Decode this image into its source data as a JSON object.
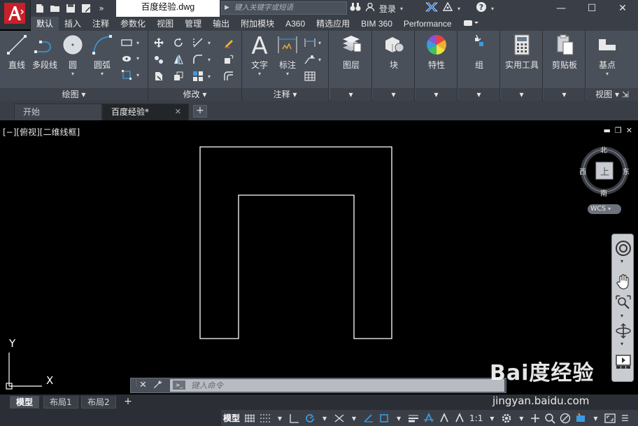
{
  "title_bar": {
    "doc_tab": "百度经验.dwg",
    "search_placeholder": "键入关键字或短语",
    "login_label": "登录",
    "help_icon": "help-icon",
    "minimize": "—",
    "maximize": "☐",
    "close": "✕"
  },
  "ribbon_tabs": [
    "默认",
    "插入",
    "注释",
    "参数化",
    "视图",
    "管理",
    "输出",
    "附加模块",
    "A360",
    "精选应用",
    "BIM 360",
    "Performance"
  ],
  "ribbon": {
    "draw": {
      "title": "绘图",
      "line": "直线",
      "polyline": "多段线",
      "circle": "圆",
      "arc": "圆弧"
    },
    "modify": {
      "title": "修改"
    },
    "annotation": {
      "title": "注释",
      "text": "文字",
      "dimension": "标注"
    },
    "layers": "图层",
    "block": "块",
    "properties": "特性",
    "groups": "组",
    "utilities": "实用工具",
    "clipboard": "剪贴板",
    "view": {
      "title": "视图",
      "base": "基点"
    }
  },
  "file_tabs": {
    "start": "开始",
    "doc": "百度经验*",
    "close": "✕",
    "add": "+"
  },
  "viewport": {
    "label": "[−][俯视][二维线框]",
    "viewcube": {
      "north": "北",
      "south": "南",
      "east": "东",
      "west": "西",
      "face": "上",
      "wcs": "WCS"
    },
    "ucs_y": "Y",
    "ucs_x": "X"
  },
  "command_line": {
    "placeholder": "键入命令",
    "close": "✕",
    "wrench": "🔧",
    "prompt": ">_"
  },
  "layout_tabs": {
    "model": "模型",
    "layout1": "布局1",
    "layout2": "布局2",
    "add": "+"
  },
  "status_bar": {
    "model": "模型",
    "scale": "1:1"
  },
  "watermark": {
    "logo": "Bai度经验",
    "url": "jingyan.baidu.com"
  },
  "colors": {
    "accent_blue": "#3b9be0",
    "app_red": "#c8202a",
    "background": "#000000",
    "ribbon": "#4a505a"
  }
}
